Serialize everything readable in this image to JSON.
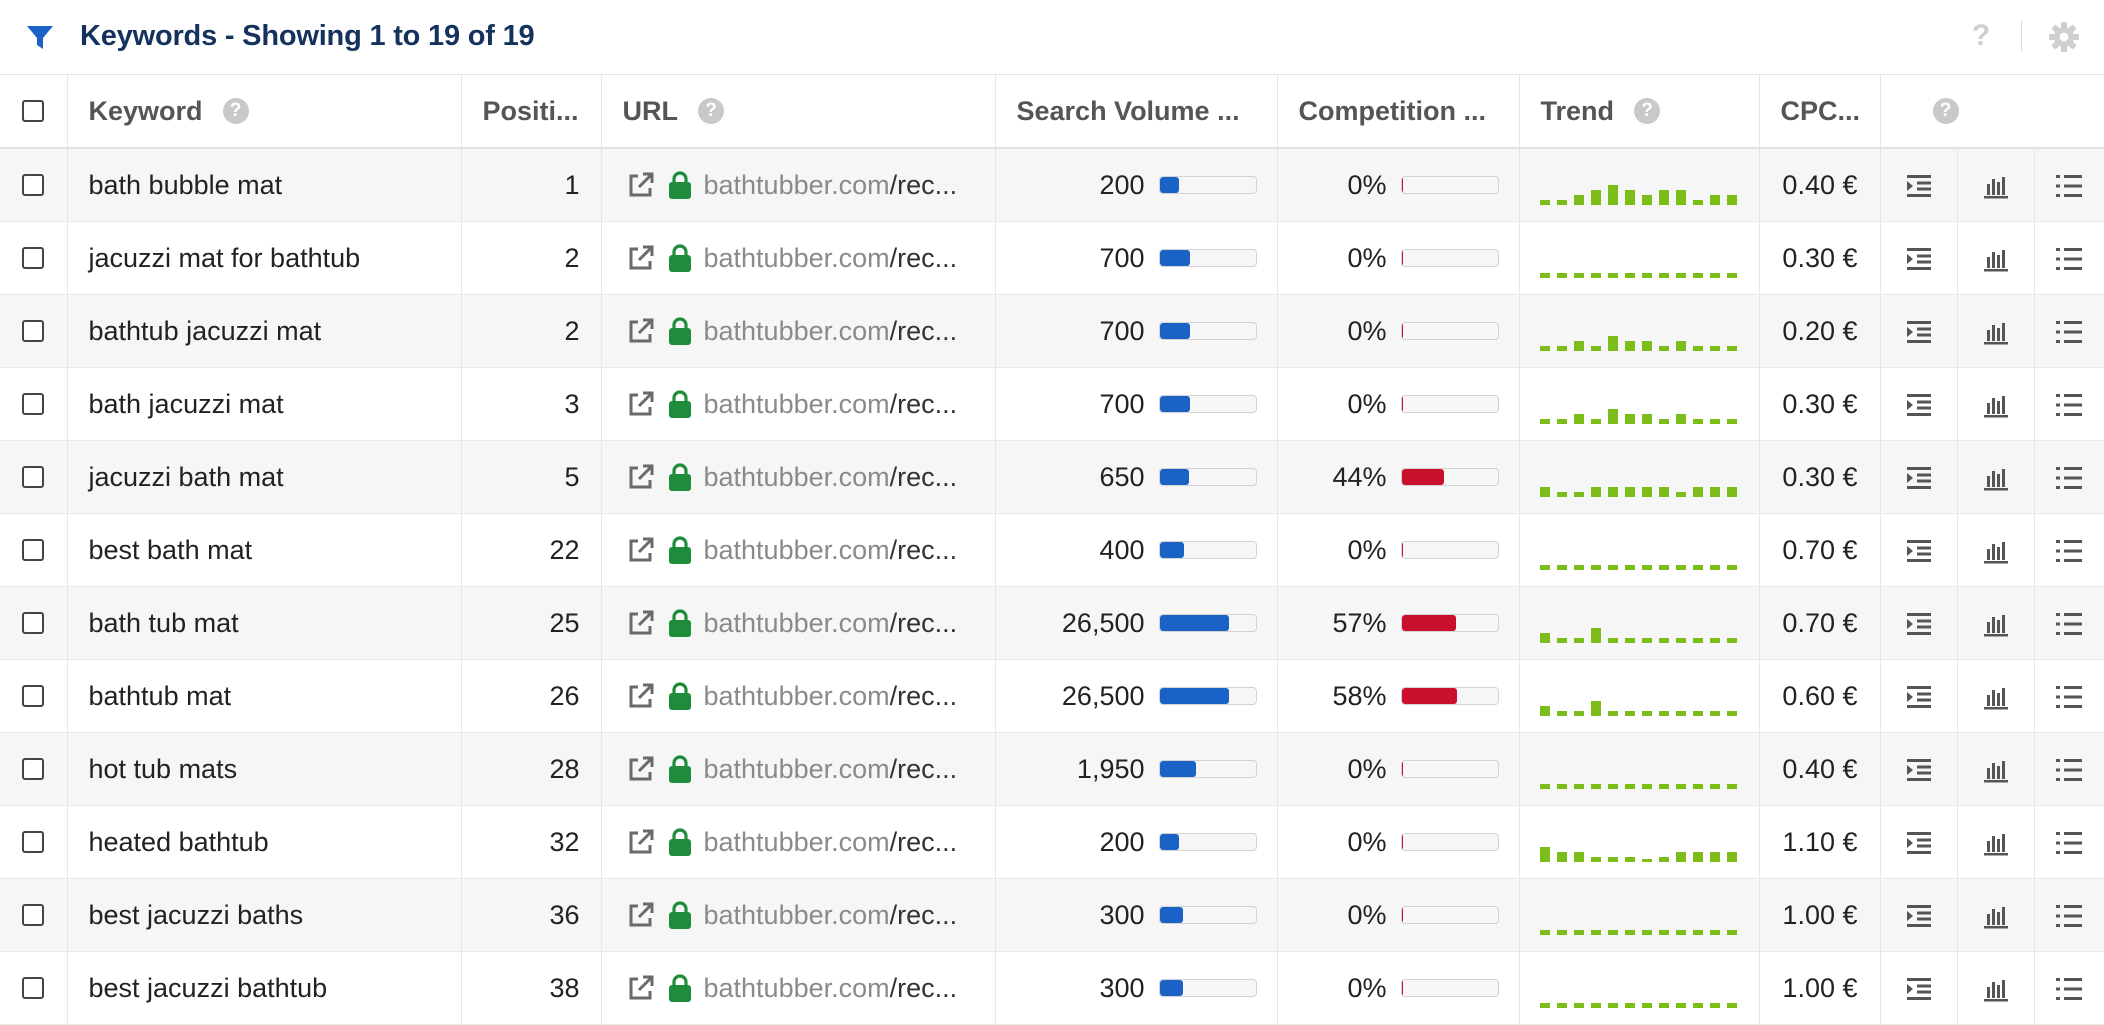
{
  "header": {
    "title": "Keywords - Showing 1 to 19 of 19",
    "help_label": "?"
  },
  "columns": {
    "keyword": "Keyword",
    "position": "Positi...",
    "url": "URL",
    "search_volume": "Search Volume ...",
    "competition": "Competition ...",
    "trend": "Trend",
    "cpc": "CPC..."
  },
  "colors": {
    "title": "#15315e",
    "filter_icon": "#1a62c5",
    "volume_bar": "#1a62c5",
    "competition_bar": "#c8102e",
    "trend_bars": "#7cbd1a",
    "lock_icon": "#1e8c3a"
  },
  "rows": [
    {
      "keyword": "bath bubble mat",
      "position": "1",
      "url_domain": "bathtubber.com",
      "url_path": "/rec...",
      "volume": "200",
      "volume_fill": 0.2,
      "competition": "0%",
      "competition_fill": 0.0,
      "trend": [
        1,
        1,
        2,
        3,
        4,
        3,
        2,
        3,
        3,
        1,
        2,
        2
      ],
      "cpc": "0.40 €"
    },
    {
      "keyword": "jacuzzi mat for bathtub",
      "position": "2",
      "url_domain": "bathtubber.com",
      "url_path": "/rec...",
      "volume": "700",
      "volume_fill": 0.32,
      "competition": "0%",
      "competition_fill": 0.0,
      "trend": [
        1,
        1,
        1,
        1,
        1,
        1,
        1,
        1,
        1,
        1,
        1,
        1
      ],
      "cpc": "0.30 €"
    },
    {
      "keyword": "bathtub jacuzzi mat",
      "position": "2",
      "url_domain": "bathtubber.com",
      "url_path": "/rec...",
      "volume": "700",
      "volume_fill": 0.32,
      "competition": "0%",
      "competition_fill": 0.0,
      "trend": [
        1,
        1,
        2,
        1,
        3,
        2,
        2,
        1,
        2,
        1,
        1,
        1
      ],
      "cpc": "0.20 €"
    },
    {
      "keyword": "bath jacuzzi mat",
      "position": "3",
      "url_domain": "bathtubber.com",
      "url_path": "/rec...",
      "volume": "700",
      "volume_fill": 0.32,
      "competition": "0%",
      "competition_fill": 0.0,
      "trend": [
        1,
        1,
        2,
        1,
        3,
        2,
        2,
        1,
        2,
        1,
        1,
        1
      ],
      "cpc": "0.30 €"
    },
    {
      "keyword": "jacuzzi bath mat",
      "position": "5",
      "url_domain": "bathtubber.com",
      "url_path": "/rec...",
      "volume": "650",
      "volume_fill": 0.31,
      "competition": "44%",
      "competition_fill": 0.44,
      "trend": [
        2,
        1,
        1,
        2,
        2,
        2,
        2,
        2,
        1,
        2,
        2,
        2
      ],
      "cpc": "0.30 €"
    },
    {
      "keyword": "best bath mat",
      "position": "22",
      "url_domain": "bathtubber.com",
      "url_path": "/rec...",
      "volume": "400",
      "volume_fill": 0.26,
      "competition": "0%",
      "competition_fill": 0.0,
      "trend": [
        1,
        1,
        1,
        1,
        1,
        1,
        1,
        1,
        1,
        1,
        1,
        1
      ],
      "cpc": "0.70 €"
    },
    {
      "keyword": "bath tub mat",
      "position": "25",
      "url_domain": "bathtubber.com",
      "url_path": "/rec...",
      "volume": "26,500",
      "volume_fill": 0.72,
      "competition": "57%",
      "competition_fill": 0.57,
      "trend": [
        2,
        1,
        1,
        3,
        1,
        1,
        1,
        1,
        1,
        1,
        1,
        1
      ],
      "cpc": "0.70 €"
    },
    {
      "keyword": "bathtub mat",
      "position": "26",
      "url_domain": "bathtubber.com",
      "url_path": "/rec...",
      "volume": "26,500",
      "volume_fill": 0.72,
      "competition": "58%",
      "competition_fill": 0.58,
      "trend": [
        2,
        1,
        1,
        3,
        1,
        1,
        1,
        1,
        1,
        1,
        1,
        1
      ],
      "cpc": "0.60 €"
    },
    {
      "keyword": "hot tub mats",
      "position": "28",
      "url_domain": "bathtubber.com",
      "url_path": "/rec...",
      "volume": "1,950",
      "volume_fill": 0.38,
      "competition": "0%",
      "competition_fill": 0.0,
      "trend": [
        1,
        1,
        1,
        1,
        1,
        1,
        1,
        1,
        1,
        1,
        1,
        1
      ],
      "cpc": "0.40 €"
    },
    {
      "keyword": "heated bathtub",
      "position": "32",
      "url_domain": "bathtubber.com",
      "url_path": "/rec...",
      "volume": "200",
      "volume_fill": 0.2,
      "competition": "0%",
      "competition_fill": 0.0,
      "trend": [
        3,
        2,
        2,
        1,
        1,
        1,
        0.5,
        1,
        2,
        2,
        2,
        2
      ],
      "cpc": "1.10 €"
    },
    {
      "keyword": "best jacuzzi baths",
      "position": "36",
      "url_domain": "bathtubber.com",
      "url_path": "/rec...",
      "volume": "300",
      "volume_fill": 0.24,
      "competition": "0%",
      "competition_fill": 0.0,
      "trend": [
        1,
        1,
        1,
        1,
        1,
        1,
        1,
        1,
        1,
        1,
        1,
        1
      ],
      "cpc": "1.00 €"
    },
    {
      "keyword": "best jacuzzi bathtub",
      "position": "38",
      "url_domain": "bathtubber.com",
      "url_path": "/rec...",
      "volume": "300",
      "volume_fill": 0.24,
      "competition": "0%",
      "competition_fill": 0.0,
      "trend": [
        1,
        1,
        1,
        1,
        1,
        1,
        1,
        1,
        1,
        1,
        1,
        1
      ],
      "cpc": "1.00 €"
    }
  ]
}
